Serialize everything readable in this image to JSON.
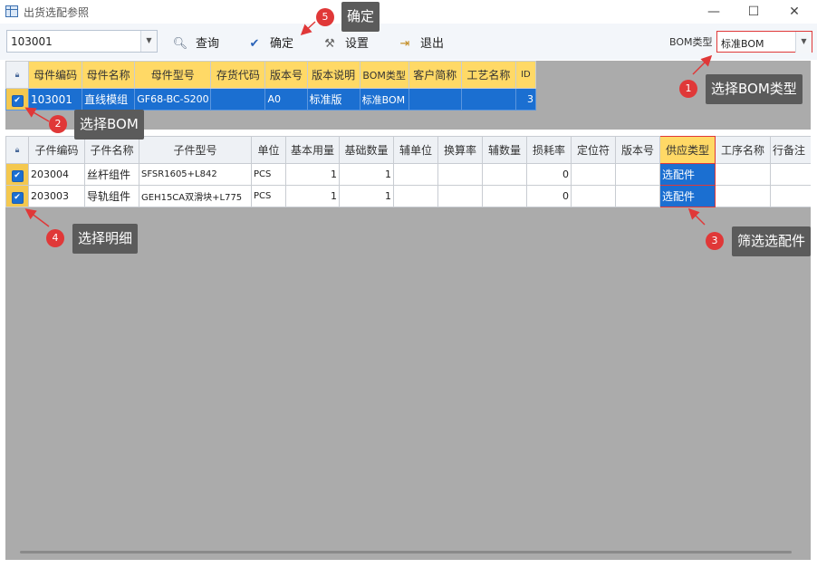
{
  "window": {
    "title": "出货选配参照",
    "minimize": "—",
    "maximize": "☐",
    "close": "✕"
  },
  "toolbar": {
    "code_value": "103001",
    "query": "查询",
    "confirm": "确定",
    "settings": "设置",
    "exit": "退出",
    "bom_type_label": "BOM类型",
    "bom_type_value": "标准BOM"
  },
  "parent_grid": {
    "headers": [
      "母件编码",
      "母件名称",
      "母件型号",
      "存货代码",
      "版本号",
      "版本说明",
      "BOM类型",
      "客户简称",
      "工艺名称",
      "ID"
    ],
    "rows": [
      [
        "103001",
        "直线模组",
        "GF68-BC-S200",
        "",
        "A0",
        "标准版",
        "标准BOM",
        "",
        "",
        "3"
      ]
    ]
  },
  "child_grid": {
    "headers": [
      "子件编码",
      "子件名称",
      "子件型号",
      "单位",
      "基本用量",
      "基础数量",
      "辅单位",
      "换算率",
      "辅数量",
      "损耗率",
      "定位符",
      "版本号",
      "供应类型",
      "工序名称",
      "行备注"
    ],
    "rows": [
      [
        "203004",
        "丝杆组件",
        "SFSR1605+L842",
        "PCS",
        "1",
        "1",
        "",
        "",
        "",
        "0",
        "",
        "",
        "选配件",
        "",
        ""
      ],
      [
        "203003",
        "导轨组件",
        "GEH15CA双滑块+L775",
        "PCS",
        "1",
        "1",
        "",
        "",
        "",
        "0",
        "",
        "",
        "选配件",
        "",
        ""
      ]
    ]
  },
  "callouts": {
    "c1": {
      "num": "1",
      "text": "选择BOM类型"
    },
    "c2": {
      "num": "2",
      "text": "选择BOM"
    },
    "c3": {
      "num": "3",
      "text": "筛选选配件"
    },
    "c4": {
      "num": "4",
      "text": "选择明细"
    },
    "c5": {
      "num": "5",
      "text": "确定"
    }
  },
  "colors": {
    "accent": "#1b6fd1",
    "highlight": "#ffd966",
    "callout_red": "#e03838",
    "callout_bg": "#5b5b5b"
  }
}
